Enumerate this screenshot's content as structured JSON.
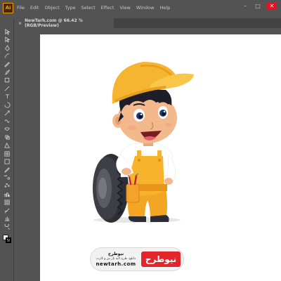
{
  "app": {
    "logo_text": "Ai",
    "menu": [
      "File",
      "Edit",
      "Object",
      "Type",
      "Select",
      "Effect",
      "View",
      "Window",
      "Help"
    ]
  },
  "window_controls": {
    "minimize": "–",
    "maximize": "□",
    "close": "✕"
  },
  "document_tab": {
    "title": "NewTarh.com @ 66.42 % (RGB/Preview)",
    "close": "×"
  },
  "toolbar": {
    "tools": [
      "selection-tool",
      "direct-selection-tool",
      "pen-tool",
      "curvature-tool",
      "pencil-tool",
      "brush-tool",
      "rectangle-tool",
      "line-tool",
      "type-tool",
      "rotate-tool",
      "scale-tool",
      "width-tool",
      "warp-tool",
      "shape-builder-tool",
      "perspective-tool",
      "mesh-tool",
      "gradient-tool",
      "eyedropper-tool",
      "blend-tool",
      "symbol-sprayer-tool",
      "column-graph-tool",
      "artboard-tool",
      "slice-tool",
      "hand-tool",
      "zoom-tool"
    ]
  },
  "artwork": {
    "subject": "cartoon-mechanic-boy-with-tire",
    "colors": {
      "cap": "#f6b530",
      "overalls": "#f7b32b",
      "shirt": "#ffffff",
      "skin": "#f3b98c",
      "hair": "#1e1e2a",
      "tire": "#2e2f36"
    }
  },
  "watermark": {
    "name": "نیوطرح",
    "tagline": "دانلود طرح لایه باز بنر و کارت",
    "url": "newtarh.com",
    "mark": "نیوطرح"
  }
}
